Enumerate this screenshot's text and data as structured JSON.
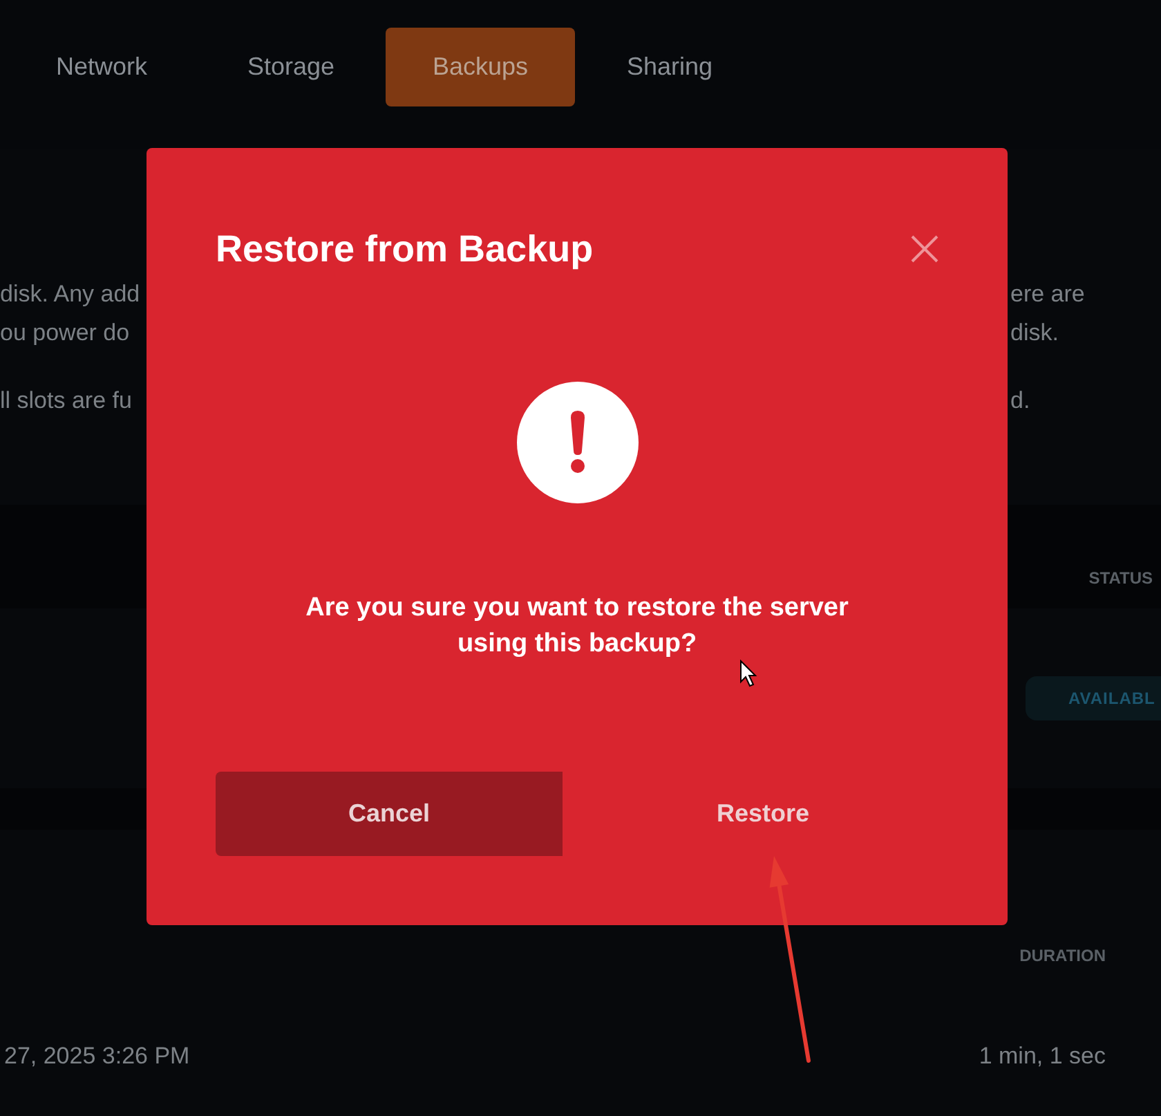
{
  "tabs": [
    {
      "label": "Network",
      "selected": false
    },
    {
      "label": "Storage",
      "selected": false
    },
    {
      "label": "Backups",
      "selected": true
    },
    {
      "label": "Sharing",
      "selected": false
    }
  ],
  "notes": [
    {
      "lines": [
        {
          "left": "disk. Any add",
          "right": "ere are"
        },
        {
          "left": "ou power do",
          "right": "disk."
        }
      ]
    },
    {
      "lines": [
        {
          "left": "ll slots are fu",
          "right": "d."
        }
      ]
    }
  ],
  "backups_table": {
    "columns": [
      "STATUS"
    ],
    "rows": [
      {
        "status": "AVAILABL"
      }
    ]
  },
  "history_table": {
    "columns": [
      "DURATION"
    ],
    "rows": [
      {
        "column_1": "27, 2025 3:26 PM",
        "duration": "1 min, 1 sec"
      }
    ]
  },
  "dialog": {
    "title": "Restore from Backup",
    "message": "Are you sure you want to restore the server using this backup?",
    "buttons": [
      {
        "label": "Cancel",
        "kind": "secondary"
      },
      {
        "label": "Restore",
        "kind": "primary"
      }
    ]
  }
}
